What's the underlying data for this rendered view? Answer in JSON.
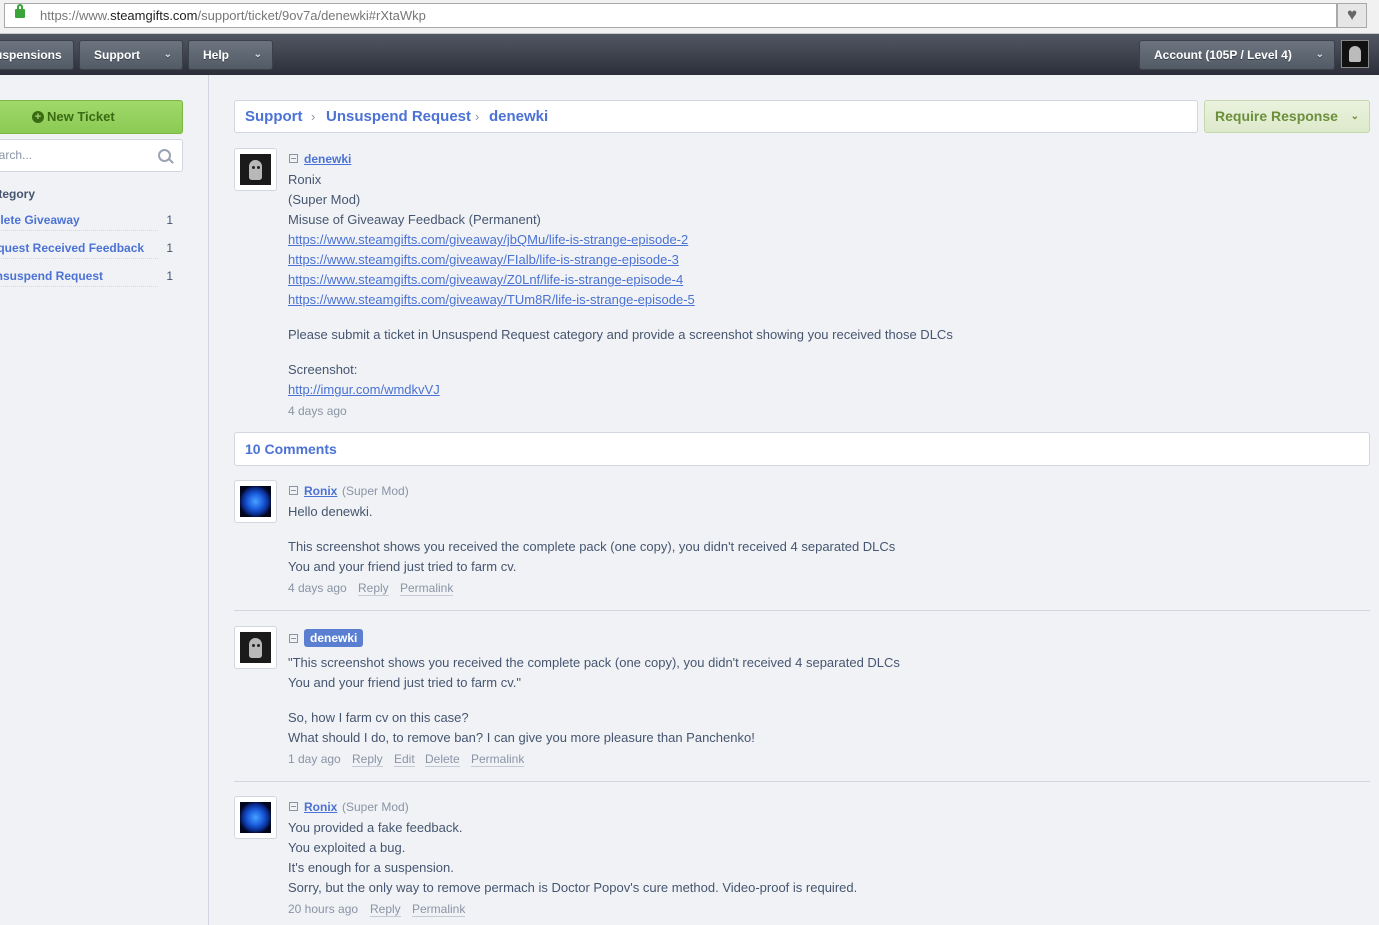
{
  "browser": {
    "url_prefix": "https://www.",
    "url_domain": "steamgifts.com",
    "url_path": "/support/ticket/9ov7a/denewki#rXtaWkp"
  },
  "nav": {
    "items": [
      "Suspensions",
      "Support",
      "Help"
    ],
    "account": "Account (105P / Level 4)"
  },
  "sidebar": {
    "new_ticket": "New Ticket",
    "search_placeholder": "Search...",
    "category_heading": "Category",
    "categories": [
      {
        "name": "Delete Giveaway",
        "count": "1"
      },
      {
        "name": "Request Received Feedback",
        "count": "1"
      },
      {
        "name": "Unsuspend Request",
        "count": "1"
      }
    ]
  },
  "breadcrumb": [
    "Support",
    "Unsuspend Request",
    "denewki"
  ],
  "status_button": "Require Response",
  "ticket": {
    "author": "denewki",
    "lines": [
      "Ronix",
      "(Super Mod)",
      "Misuse of Giveaway Feedback (Permanent)"
    ],
    "links": [
      "https://www.steamgifts.com/giveaway/jbQMu/life-is-strange-episode-2",
      "https://www.steamgifts.com/giveaway/FIalb/life-is-strange-episode-3",
      "https://www.steamgifts.com/giveaway/Z0Lnf/life-is-strange-episode-4",
      "https://www.steamgifts.com/giveaway/TUm8R/life-is-strange-episode-5"
    ],
    "instruction": "Please submit a ticket in Unsuspend Request category and provide a screenshot showing you received those DLCs",
    "screenshot_label": "Screenshot:",
    "screenshot_link": "http://imgur.com/wmdkvVJ",
    "time": "4 days ago"
  },
  "comments_header": "10 Comments",
  "comments": [
    {
      "author": "Ronix",
      "role": "(Super Mod)",
      "lines": [
        "Hello denewki.",
        "This screenshot shows you received the complete pack (one copy), you didn't received 4 separated DLCs",
        "You and your friend just tried to farm cv."
      ],
      "time": "4 days ago",
      "actions": [
        "Reply",
        "Permalink"
      ]
    },
    {
      "author": "denewki",
      "lines": [
        "\"This screenshot shows you received the complete pack (one copy), you didn't received 4 separated DLCs",
        "You and your friend just tried to farm cv.\"",
        "So, how I farm cv on this case?",
        "What should I do, to remove ban? I can give you more pleasure than Panchenko!"
      ],
      "time": "1 day ago",
      "actions": [
        "Reply",
        "Edit",
        "Delete",
        "Permalink"
      ]
    },
    {
      "author": "Ronix",
      "role": "(Super Mod)",
      "lines": [
        "You provided a fake feedback.",
        "You exploited a bug.",
        "It's enough for a suspension.",
        "Sorry, but the only way to remove permach is Doctor Popov's cure method. Video-proof is required."
      ],
      "time": "20 hours ago",
      "actions": [
        "Reply",
        "Permalink"
      ]
    }
  ]
}
